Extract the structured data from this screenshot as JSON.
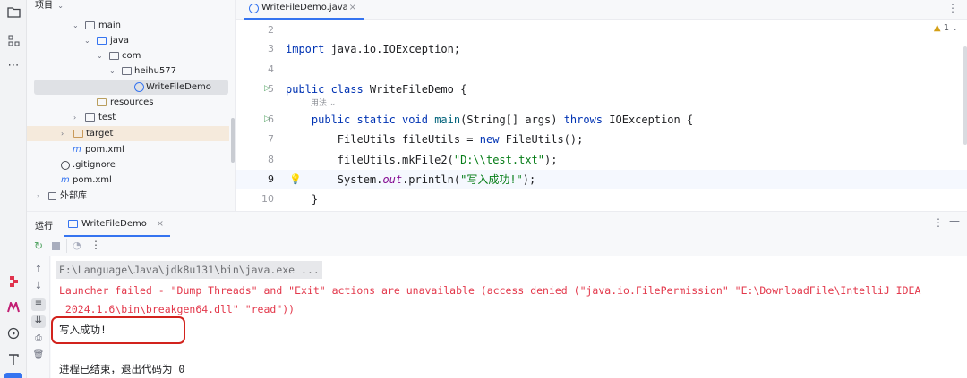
{
  "colors": {
    "accent": "#3574f0",
    "error_text": "#e3384b",
    "annotation_box": "#d2231d",
    "keyword": "#0033b3",
    "string": "#067d17"
  },
  "project_panel": {
    "title": "项目",
    "tree": [
      {
        "label": "main",
        "type": "folder",
        "expanded": true
      },
      {
        "label": "java",
        "type": "source-folder",
        "expanded": true
      },
      {
        "label": "com",
        "type": "package",
        "expanded": true
      },
      {
        "label": "heihu577",
        "type": "package",
        "expanded": true
      },
      {
        "label": "WriteFileDemo",
        "type": "java-class",
        "selected": true
      },
      {
        "label": "resources",
        "type": "resources-folder"
      },
      {
        "label": "test",
        "type": "folder",
        "expanded": false
      },
      {
        "label": "target",
        "type": "excluded-folder",
        "expanded": false
      },
      {
        "label": "pom.xml",
        "type": "maven-file"
      },
      {
        "label": ".gitignore",
        "type": "ignore-file"
      },
      {
        "label": "pom.xml",
        "type": "maven-file"
      },
      {
        "label": "外部库",
        "type": "library",
        "expanded": false
      }
    ]
  },
  "editor": {
    "tab_label": "WriteFileDemo.java",
    "inspection_count": "1",
    "lines": [
      {
        "num": "2",
        "text": ""
      },
      {
        "num": "3",
        "text": "import java.io.IOException;"
      },
      {
        "num": "4",
        "text": ""
      },
      {
        "num": "5",
        "text": "public class WriteFileDemo {"
      },
      {
        "num": "",
        "text": "用法"
      },
      {
        "num": "6",
        "text": "    public static void main(String[] args) throws IOException {"
      },
      {
        "num": "7",
        "text": "        FileUtils fileUtils = new FileUtils();"
      },
      {
        "num": "8",
        "text": "        fileUtils.mkFile2(\"D:\\\\test.txt\");"
      },
      {
        "num": "9",
        "text": "        System.out.println(\"写入成功!\");"
      },
      {
        "num": "10",
        "text": "    }"
      }
    ]
  },
  "run_panel": {
    "label": "运行",
    "tab_label": "WriteFileDemo",
    "console": {
      "command": "E:\\Language\\Java\\jdk8u131\\bin\\java.exe ...",
      "error_line_1": "Launcher failed - \"Dump Threads\" and \"Exit\" actions are unavailable (access denied (\"java.io.FilePermission\" \"E:\\DownloadFile\\IntelliJ IDEA",
      "error_line_2": " 2024.1.6\\bin\\breakgen64.dll\" \"read\"))",
      "output": "写入成功!",
      "exit_message": "进程已结束，退出代码为 0"
    }
  }
}
